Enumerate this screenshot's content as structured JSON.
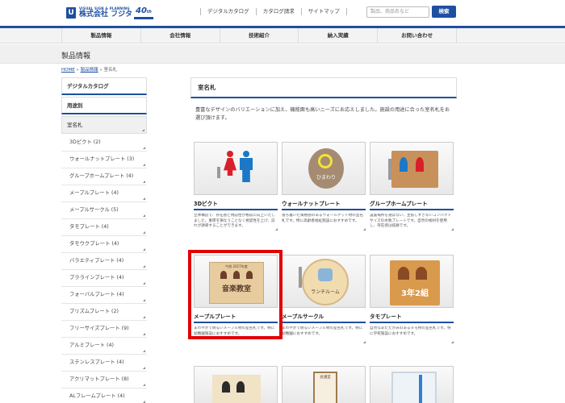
{
  "header": {
    "logo_sub": "VISUAL SIGN & PLANNING",
    "logo_name": "株式会社 フジタ",
    "anniversary": "40",
    "anniversary_suffix": "th",
    "links": [
      "デジタルカタログ",
      "カタログ請求",
      "サイトマップ"
    ],
    "search_placeholder": "製品、商品名など",
    "search_button": "検索"
  },
  "nav": {
    "items": [
      "製品情報",
      "会社情報",
      "技術紹介",
      "納入実績",
      "お問い合わせ"
    ]
  },
  "page": {
    "title": "製品情報",
    "breadcrumb": [
      "HOME",
      "製品情報",
      "室名札"
    ],
    "breadcrumb_sep": " » "
  },
  "sidebar": {
    "digital_catalog": "デジタルカタログ",
    "by_use": "用途別",
    "category": "室名札",
    "items": [
      "3Dピクト (2)",
      "ウォールナットプレート (3)",
      "グループホームプレート (4)",
      "メープルプレート (4)",
      "メープルサークル (5)",
      "タモプレート (4)",
      "タモウクプレート (4)",
      "バラエティプレート (4)",
      "プララインプレート (4)",
      "フォーバルプレート (4)",
      "プリズムプレート (2)",
      "フリーサイズプレート (9)",
      "アルミプレート (4)",
      "ステンレスプレート (4)",
      "アクリマットプレート (8)",
      "ALフレームプレート (4)"
    ]
  },
  "main": {
    "section_title": "室名札",
    "intro": "豊富なデザインのバリエーションに加え、機能面も高いニーズにお応えしました。施設の用途に合った室名札をお選び頂けます。",
    "products": [
      {
        "title": "3Dピクト",
        "desc": "立体構造で、存在感と視認性が格段に向上いたしました。重厚を損なうことなく視認性を上げ、訪れが誘導することができます。"
      },
      {
        "title": "ウォールナットプレート",
        "desc": "落ち着いた風格感のあるウォールナット材の室名札です。特に高齢者福祉施設におすすめです。"
      },
      {
        "title": "グループホームプレート",
        "desc": "設置場所を選ばない、主張しすぎないコンパクトサイズの木製プレートです。自然の格材を使用し、存在感は抜群です。"
      },
      {
        "title": "メープルプレート",
        "desc": "まわやかで明るいメープル材の室名札です。特に幼稚園施設におすすめです。"
      },
      {
        "title": "メープルサークル",
        "desc": "まわやかで明るいメープル材の室名札です。特に幼稚園におすすめです。"
      },
      {
        "title": "タモプレート",
        "desc": "自然なあたたかみのあるタモ材の室名札です。特に学校施設におすすめです。"
      }
    ],
    "image_labels": {
      "walnut_sign": "ひまわり",
      "maple_sign": "音楽教室",
      "maple_sign_top": "午前 2017年度",
      "circle_sign": "ランチルーム",
      "tamo_sign": "3年2組",
      "row3_sign": "会議室"
    }
  },
  "colors": {
    "brand_blue": "#1e4fa0",
    "highlight_red": "#e20000"
  }
}
